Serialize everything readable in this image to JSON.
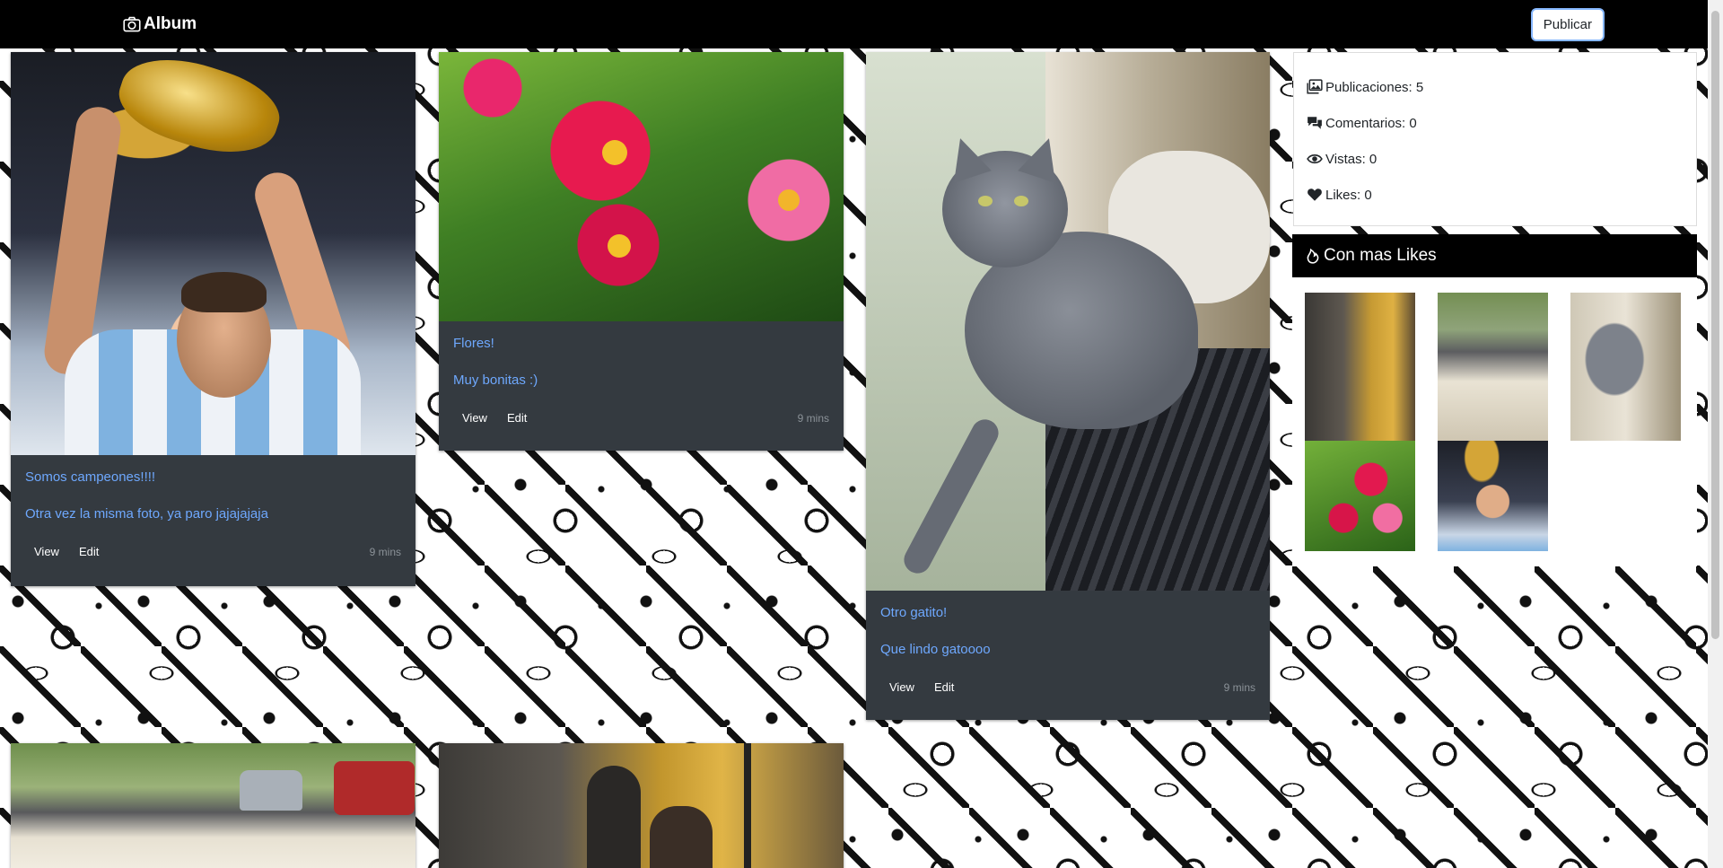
{
  "navbar": {
    "brand": "Album",
    "brand_icon": "camera-icon",
    "publish_label": "Publicar"
  },
  "posts": [
    {
      "title": "Somos campeones!!!!",
      "text": "Otra vez la misma foto, ya paro jajajajaja",
      "view": "View",
      "edit": "Edit",
      "time": "9 mins"
    },
    {
      "title": "Flores!",
      "text": "Muy bonitas :)",
      "view": "View",
      "edit": "Edit",
      "time": "9 mins"
    },
    {
      "title": "Otro gatito!",
      "text": "Que lindo gatoooo",
      "view": "View",
      "edit": "Edit",
      "time": "9 mins"
    }
  ],
  "stats": {
    "publicaciones": "Publicaciones: 5",
    "comentarios": "Comentarios: 0",
    "vistas": "Vistas: 0",
    "likes": "Likes: 0"
  },
  "top": {
    "title": "Con mas Likes",
    "icon": "fire-icon"
  },
  "colors": {
    "navbar": "#000000",
    "card": "#343a40",
    "link": "#6ea8fe"
  }
}
